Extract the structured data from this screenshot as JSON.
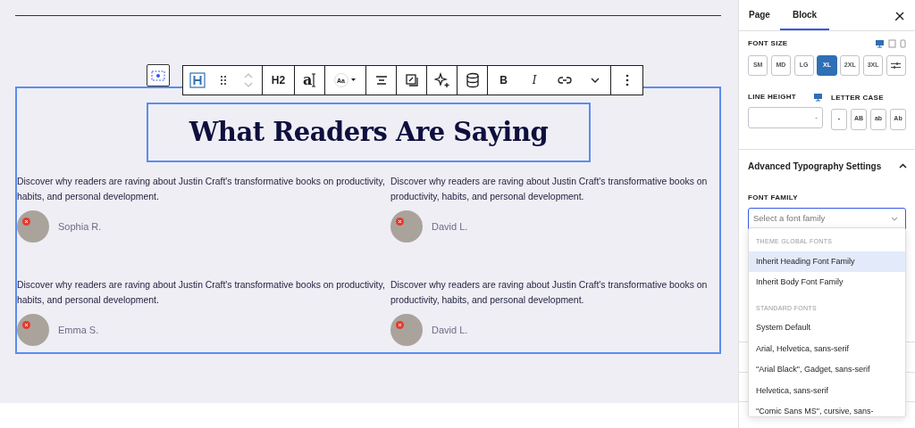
{
  "canvas": {
    "heading": "What Readers Are Saying",
    "testimonials": [
      {
        "quote": "Discover why readers are raving about Justin Craft's transformative books on productivity, habits, and personal development.",
        "name": "Sophia R."
      },
      {
        "quote": "Discover why readers are raving about Justin Craft's transformative books on productivity, habits, and personal development.",
        "name": "David L."
      },
      {
        "quote": "Discover why readers are raving about Justin Craft's transformative books on productivity, habits, and personal development.",
        "name": "Emma S."
      },
      {
        "quote": "Discover why readers are raving about Justin Craft's transformative books on productivity, habits, and personal development.",
        "name": "David L."
      }
    ]
  },
  "block_toolbar": {
    "items": [
      {
        "kind": "heading"
      },
      {
        "kind": "drag"
      },
      {
        "kind": "mover"
      },
      {
        "kind": "text",
        "label": "H2"
      },
      {
        "kind": "typography",
        "glyph": "a"
      },
      {
        "kind": "font",
        "glyph": "Aa"
      },
      {
        "kind": "align"
      },
      {
        "kind": "box"
      },
      {
        "kind": "sparkle"
      },
      {
        "kind": "database"
      },
      {
        "kind": "text",
        "label": "B"
      },
      {
        "kind": "italic",
        "label": "I"
      },
      {
        "kind": "link"
      },
      {
        "kind": "chevron"
      },
      {
        "kind": "options"
      }
    ]
  },
  "sidebar": {
    "tabs": [
      {
        "label": "Page",
        "selected": false
      },
      {
        "label": "Block",
        "selected": true
      }
    ],
    "font_size": {
      "label": "FONT SIZE",
      "devices": [
        {
          "kind": "desktop",
          "selected": true
        },
        {
          "kind": "tablet",
          "selected": false
        },
        {
          "kind": "mobile",
          "selected": false
        }
      ],
      "options": [
        {
          "label": "SM",
          "selected": false
        },
        {
          "label": "MD",
          "selected": false
        },
        {
          "label": "LG",
          "selected": false
        },
        {
          "label": "XL",
          "selected": true
        },
        {
          "label": "2XL",
          "selected": false
        },
        {
          "label": "3XL",
          "selected": false
        }
      ]
    },
    "line_height": {
      "label": "LINE HEIGHT",
      "unit": "-"
    },
    "letter_case": {
      "label": "LETTER CASE",
      "options": [
        "-",
        "AB",
        "ab",
        "Ab"
      ]
    },
    "advanced": {
      "title": "Advanced Typography Settings",
      "expanded": true
    },
    "font_family": {
      "label": "FONT FAMILY",
      "placeholder": "Select a font family",
      "groups": [
        {
          "heading": "THEME GLOBAL FONTS",
          "options": [
            {
              "label": "Inherit Heading Font Family",
              "selected": true
            },
            {
              "label": "Inherit Body Font Family",
              "selected": false
            }
          ]
        },
        {
          "heading": "STANDARD FONTS",
          "options": [
            {
              "label": "System Default",
              "selected": false
            },
            {
              "label": "Arial, Helvetica, sans-serif",
              "selected": false
            },
            {
              "label": "\"Arial Black\", Gadget, sans-serif",
              "selected": false
            },
            {
              "label": "Helvetica, sans-serif",
              "selected": false
            },
            {
              "label": "\"Comic Sans MS\", cursive, sans-",
              "selected": false
            }
          ]
        }
      ]
    }
  }
}
